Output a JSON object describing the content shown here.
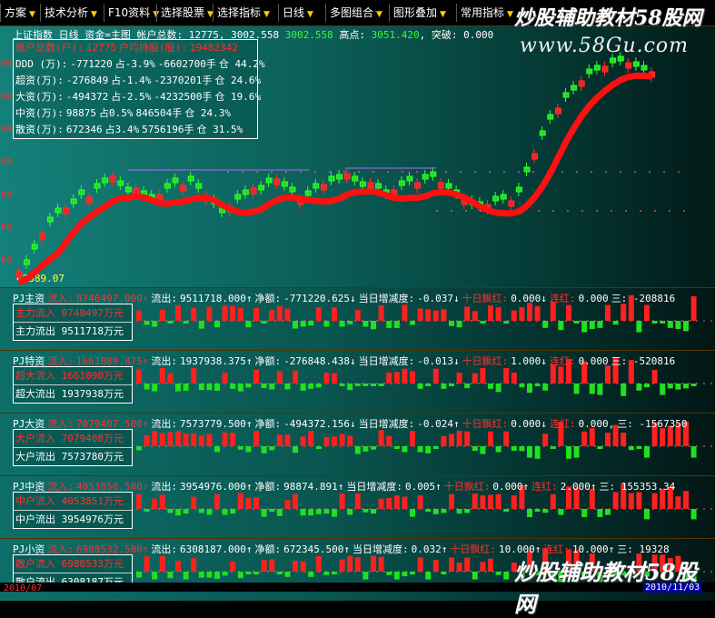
{
  "toolbar": {
    "items": [
      "方案",
      "技术分析",
      "F10资料",
      "选择股票",
      "选择指标",
      "日线",
      "多图组合",
      "图形叠加",
      "常用指标"
    ]
  },
  "watermark": {
    "line1": "炒股辅助教材58股网",
    "line2": "www.58Gu.com",
    "line3": "炒股辅助教材58股网"
  },
  "main": {
    "header": {
      "name": "上证指数",
      "period": "日线",
      "fund": "资金=主图",
      "account_label": "帐户总数:",
      "account_value": "12775",
      "v1": "3002.558",
      "v2": "3002.558",
      "high_label": "高点:",
      "high_value": "3051.420",
      "break_label": "突破:",
      "break_value": "0.000"
    },
    "info": [
      {
        "label": "帐户总数(户):",
        "value": "12775",
        "extra": "户均持股(股):",
        "extra_value": "19482342"
      },
      {
        "label": "DDD (万):",
        "value": "-771220",
        "pct": "占-3.9%",
        "hand": "-6602700手",
        "pos": "仓 44.2%"
      },
      {
        "label": "超资(万):",
        "value": "-276849",
        "pct": "占-1.4%",
        "hand": "-2370201手",
        "pos": "仓 24.6%"
      },
      {
        "label": "大资(万):",
        "value": "-494372",
        "pct": "占-2.5%",
        "hand": "-4232500手",
        "pos": "仓 19.6%"
      },
      {
        "label": "中资(万):",
        "value": "98875",
        "pct": "占0.5%",
        "hand": "846504手",
        "pos": "仓 24.3%"
      },
      {
        "label": "散资(万):",
        "value": "672346",
        "pct": "占3.4%",
        "hand": "5756196手",
        "pos": "仓 31.5%"
      }
    ],
    "low_tag": "←2389.07",
    "axis_labels": [
      "00",
      "00",
      "00",
      "00",
      "00",
      "00",
      "00",
      "00"
    ]
  },
  "subs": [
    {
      "title": "PJ主资",
      "in_label": "流入:",
      "in_value": "8740497.000↑",
      "out_label": "流出:",
      "out_value": "9511718.000↑",
      "net_label": "净额:",
      "net_value": "-771220.625↓",
      "chg_label": "当日增减度:",
      "chg_value": "-0.037↓",
      "ten_label": "十日飘红:",
      "ten_value": "0.000↓",
      "cons_label": "连红:",
      "cons_value": "0.000",
      "tail": "三: -208816",
      "leg_in": "主力流入 8740497万元",
      "leg_out": "主力流出 9511718万元"
    },
    {
      "title": "PJ特资",
      "in_label": "流入:",
      "in_value": "1661089.875↑",
      "out_label": "流出:",
      "out_value": "1937938.375↑",
      "net_label": "净额:",
      "net_value": "-276848.438↓",
      "chg_label": "当日增减度:",
      "chg_value": "-0.013↓",
      "ten_label": "十日飘红:",
      "ten_value": "1.000↓",
      "cons_label": "连红:",
      "cons_value": "0.000",
      "tail": "三: -520816",
      "leg_in": "超大流入 1661090万元",
      "leg_out": "超大流出 1937938万元"
    },
    {
      "title": "PJ大资",
      "in_label": "流入:",
      "in_value": "7079407.500↑",
      "out_label": "流出:",
      "out_value": "7573779.500↑",
      "net_label": "净额:",
      "net_value": "-494372.156↓",
      "chg_label": "当日增减度:",
      "chg_value": "-0.024↑",
      "ten_label": "十日飘红:",
      "ten_value": "0.000↓",
      "cons_label": "连红:",
      "cons_value": "0.000,",
      "tail": "三: -1567350",
      "leg_in": "大户流入 7079408万元",
      "leg_out": "大户流出 7573780万元"
    },
    {
      "title": "PJ中资",
      "in_label": "流入:",
      "in_value": "4053850.500↑",
      "out_label": "流出:",
      "out_value": "3954976.000↑",
      "net_label": "净额:",
      "net_value": "98874.891↑",
      "chg_label": "当日增减度:",
      "chg_value": "0.005↑",
      "ten_label": "十日飘红:",
      "ten_value": "0.000↑",
      "cons_label": "连红:",
      "cons_value": "2.000↑",
      "tail": "三: 155353.34",
      "leg_in": "中户流入 4053851万元",
      "leg_out": "中户流出 3954976万元"
    },
    {
      "title": "PJ小资",
      "in_label": "流入:",
      "in_value": "6980532.500↑",
      "out_label": "流出:",
      "out_value": "6308187.000↑",
      "net_label": "净额:",
      "net_value": "672345.500↑",
      "chg_label": "当日增减度:",
      "chg_value": "0.032↑",
      "ten_label": "十日飘红:",
      "ten_value": "10.000↑",
      "cons_label": "连红:",
      "cons_value": "10.000↑",
      "tail": "三: 19328",
      "leg_in": "散户流入 6980533万元",
      "leg_out": "散户流出 6308187万元"
    }
  ],
  "date_left": "2010/07",
  "date_right": "2010/11/03",
  "colors": {
    "up": "#ff2020",
    "down": "#20e020",
    "bg": "#0a5650",
    "text": "#ffffff",
    "accent": "#ffd000"
  }
}
